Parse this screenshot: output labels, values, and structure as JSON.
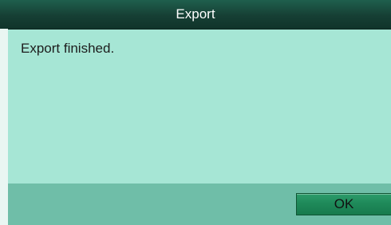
{
  "dialog": {
    "title": "Export",
    "message": "Export finished.",
    "ok_label": "OK"
  },
  "colors": {
    "titlebar": "#163f34",
    "body": "#a6e6d5",
    "footer": "#6fbea8",
    "ok_button": "#1f8a5a"
  }
}
